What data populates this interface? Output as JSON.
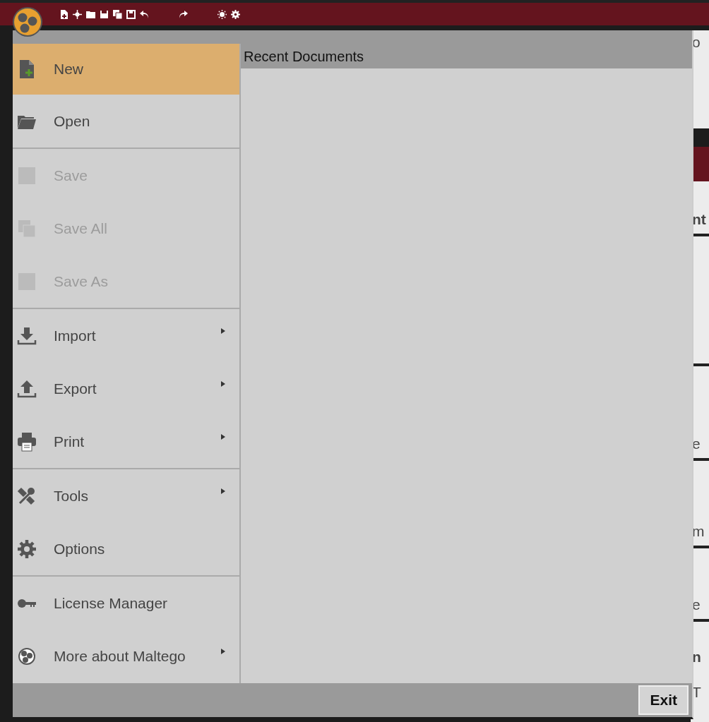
{
  "menu_groups": [
    [
      {
        "label": "New",
        "selected": true,
        "disabled": false,
        "submenu": false
      },
      {
        "label": "Open",
        "selected": false,
        "disabled": false,
        "submenu": false
      }
    ],
    [
      {
        "label": "Save",
        "selected": false,
        "disabled": true,
        "submenu": false
      },
      {
        "label": "Save All",
        "selected": false,
        "disabled": true,
        "submenu": false
      },
      {
        "label": "Save As",
        "selected": false,
        "disabled": true,
        "submenu": false
      }
    ],
    [
      {
        "label": "Import",
        "selected": false,
        "disabled": false,
        "submenu": true
      },
      {
        "label": "Export",
        "selected": false,
        "disabled": false,
        "submenu": true
      },
      {
        "label": "Print",
        "selected": false,
        "disabled": false,
        "submenu": true
      }
    ],
    [
      {
        "label": "Tools",
        "selected": false,
        "disabled": false,
        "submenu": true
      },
      {
        "label": "Options",
        "selected": false,
        "disabled": false,
        "submenu": false
      }
    ],
    [
      {
        "label": "License Manager",
        "selected": false,
        "disabled": false,
        "submenu": false
      },
      {
        "label": "More about Maltego",
        "selected": false,
        "disabled": false,
        "submenu": true
      }
    ]
  ],
  "recent_documents": {
    "title": "Recent Documents"
  },
  "exit_button": "Exit",
  "background_letters": [
    "o",
    "nt",
    "e",
    "m",
    "e",
    "n",
    "T"
  ]
}
